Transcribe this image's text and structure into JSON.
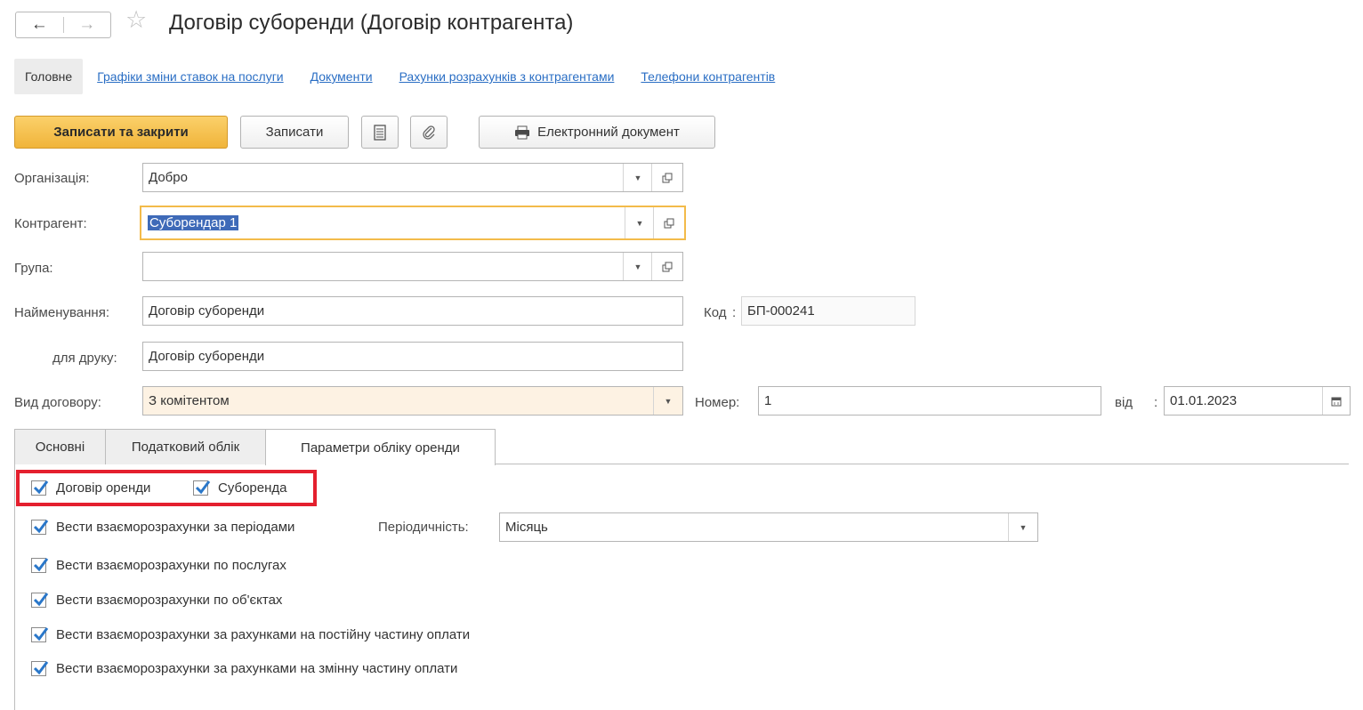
{
  "window": {
    "title": "Договір суборенди (Договір контрагента)",
    "back_icon": "←",
    "forward_icon": "→",
    "star_icon": "☆"
  },
  "tabs_top": [
    {
      "label": "Головне",
      "active": true
    },
    {
      "label": "Графіки зміни ставок на послуги"
    },
    {
      "label": "Документи"
    },
    {
      "label": "Рахунки розрахунків з контрагентами"
    },
    {
      "label": "Телефони контрагентів"
    }
  ],
  "toolbar": {
    "save_close": "Записати та закрити",
    "save": "Записати",
    "edoc": "Електронний документ"
  },
  "form": {
    "org_label": "Організація:",
    "org_value": "Добро",
    "contractor_label": "Контрагент:",
    "contractor_value": "Суборендар 1",
    "group_label": "Група:",
    "group_value": "",
    "name_label": "Найменування:",
    "name_value": "Договір суборенди",
    "code_label": "Код",
    "code_sep": ":",
    "code_value": "БП-000241",
    "print_label": "для друку:",
    "print_value": "Договір суборенди",
    "kind_label": "Вид договору:",
    "kind_value": "З комітентом",
    "number_label": "Номер:",
    "number_value": "1",
    "date_label": "від",
    "date_sep": ":",
    "date_value": "01.01.2023"
  },
  "tabs_bottom": [
    {
      "label": "Основні"
    },
    {
      "label": "Податковий облік"
    },
    {
      "label": "Параметри обліку оренди",
      "active": true
    }
  ],
  "lease": {
    "lease_contract": "Договір оренди",
    "sublease": "Суборенда",
    "by_periods": "Вести взаєморозрахунки за періодами",
    "periodicity_label": "Періодичність:",
    "periodicity_value": "Місяць",
    "by_services": "Вести взаєморозрахунки по послугах",
    "by_objects": "Вести взаєморозрахунки по об'єктах",
    "by_fixed": "Вести взаєморозрахунки за рахунками на постійну частину оплати",
    "by_variable": "Вести взаєморозрахунки за рахунками на змінну частину оплати"
  },
  "colors": {
    "accent": "#f0b43a",
    "link": "#2a6ec4",
    "highlight": "#e4202e",
    "check": "#2a77c9"
  }
}
